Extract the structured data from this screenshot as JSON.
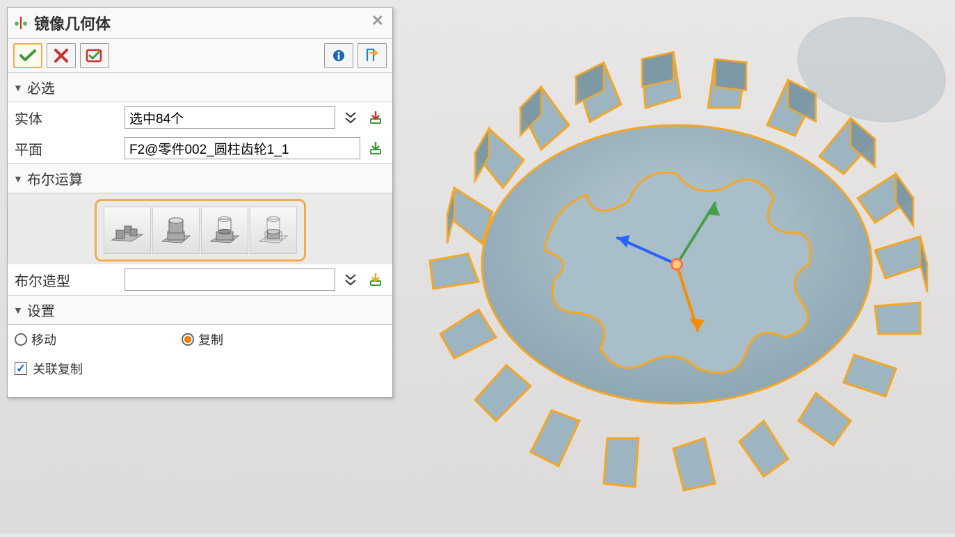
{
  "dialog": {
    "title": "镜像几何体"
  },
  "sections": {
    "required": {
      "title": "必选",
      "entity_label": "实体",
      "entity_value": "选中84个",
      "plane_label": "平面",
      "plane_value": "F2@零件002_圆柱齿轮1_1"
    },
    "boolean": {
      "title": "布尔运算",
      "shape_label": "布尔造型",
      "shape_value": ""
    },
    "settings": {
      "title": "设置",
      "move_label": "移动",
      "copy_label": "复制",
      "assoc_copy_label": "关联复制",
      "selected_radio": "copy",
      "assoc_copy_checked": true
    }
  }
}
